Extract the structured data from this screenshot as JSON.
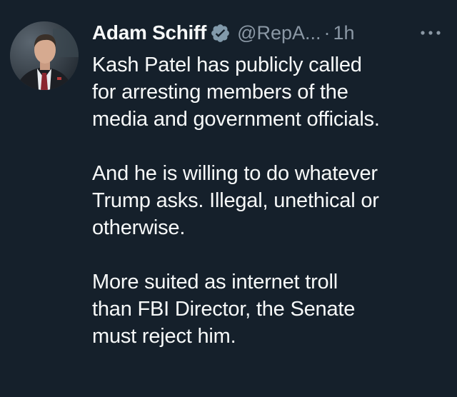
{
  "tweet": {
    "display_name": "Adam Schiff",
    "handle": "@RepA...",
    "separator": "·",
    "time": "1h",
    "verified_icon": "verified-badge-icon",
    "more_icon": "more-options-icon",
    "avatar_icon": "profile-photo",
    "paragraphs": [
      [
        "Kash Patel has publicly called",
        "for arresting members of the",
        "media and government officials."
      ],
      [
        "And he is willing to do whatever",
        "Trump asks. Illegal, unethical or",
        "otherwise."
      ],
      [
        "More suited as internet troll",
        "than FBI Director, the Senate",
        "must reject him."
      ]
    ]
  },
  "colors": {
    "background": "#15202b",
    "text_primary": "#f7f9f9",
    "text_secondary": "#8b98a5",
    "verified_badge": "#829aab"
  }
}
